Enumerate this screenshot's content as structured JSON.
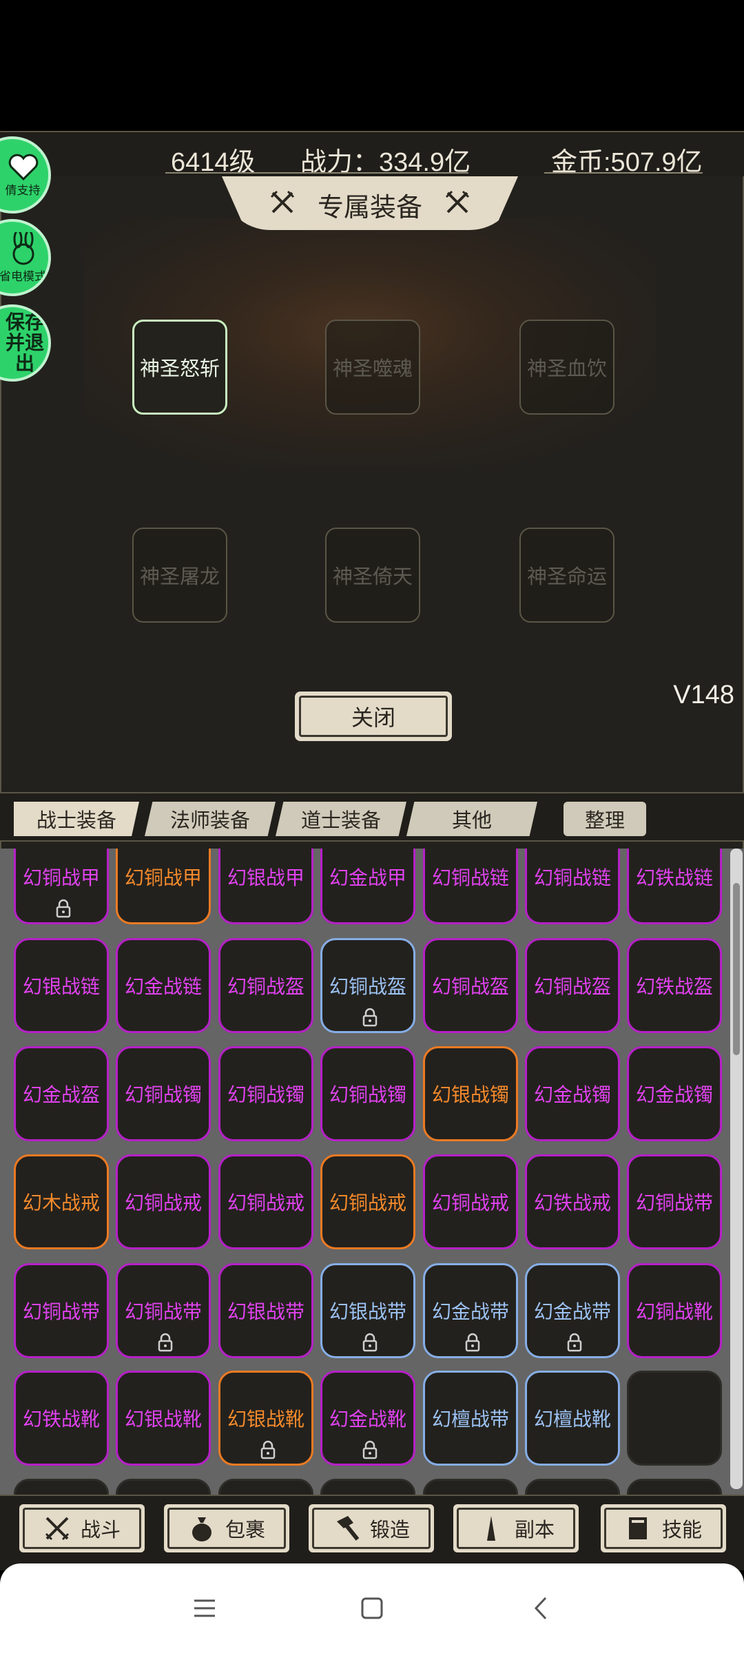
{
  "header": {
    "level": "6414级",
    "power": "战力：334.9亿",
    "gold": "金币:507.9亿"
  },
  "panel": {
    "title": "专属装备",
    "slots": [
      "神圣怒斩",
      "神圣噬魂",
      "神圣血饮",
      "神圣屠龙",
      "神圣倚天",
      "神圣命运"
    ],
    "version": "V148",
    "close_label": "关闭"
  },
  "side": {
    "support": "倩支持",
    "power_mode": "省电模式",
    "save_exit": "保存并退出"
  },
  "tabs": [
    "战士装备",
    "法师装备",
    "道士装备",
    "其他"
  ],
  "sort_label": "整理",
  "inventory": [
    [
      [
        "幻铜战甲",
        "p",
        true
      ],
      [
        "幻铜战甲",
        "o",
        false
      ],
      [
        "幻银战甲",
        "p",
        false
      ],
      [
        "幻金战甲",
        "p",
        false
      ],
      [
        "幻铜战链",
        "p",
        false
      ],
      [
        "幻铜战链",
        "p",
        false
      ],
      [
        "幻铁战链",
        "p",
        false
      ]
    ],
    [
      [
        "幻银战链",
        "p",
        false
      ],
      [
        "幻金战链",
        "p",
        false
      ],
      [
        "幻铜战盔",
        "p",
        false
      ],
      [
        "幻铜战盔",
        "b",
        true
      ],
      [
        "幻铜战盔",
        "p",
        false
      ],
      [
        "幻铜战盔",
        "p",
        false
      ],
      [
        "幻铁战盔",
        "p",
        false
      ]
    ],
    [
      [
        "幻金战盔",
        "p",
        false
      ],
      [
        "幻铜战镯",
        "p",
        false
      ],
      [
        "幻铜战镯",
        "p",
        false
      ],
      [
        "幻铜战镯",
        "p",
        false
      ],
      [
        "幻银战镯",
        "o",
        false
      ],
      [
        "幻金战镯",
        "p",
        false
      ],
      [
        "幻金战镯",
        "p",
        false
      ]
    ],
    [
      [
        "幻木战戒",
        "o",
        false
      ],
      [
        "幻铜战戒",
        "p",
        false
      ],
      [
        "幻铜战戒",
        "p",
        false
      ],
      [
        "幻铜战戒",
        "o",
        false
      ],
      [
        "幻铜战戒",
        "p",
        false
      ],
      [
        "幻铁战戒",
        "p",
        false
      ],
      [
        "幻铜战带",
        "p",
        false
      ]
    ],
    [
      [
        "幻铜战带",
        "p",
        false
      ],
      [
        "幻铜战带",
        "p",
        true
      ],
      [
        "幻银战带",
        "p",
        false
      ],
      [
        "幻银战带",
        "b",
        true
      ],
      [
        "幻金战带",
        "b",
        true
      ],
      [
        "幻金战带",
        "b",
        true
      ],
      [
        "幻铜战靴",
        "p",
        false
      ]
    ],
    [
      [
        "幻铁战靴",
        "p",
        false
      ],
      [
        "幻银战靴",
        "p",
        false
      ],
      [
        "幻银战靴",
        "o",
        true
      ],
      [
        "幻金战靴",
        "p",
        true
      ],
      [
        "幻檀战带",
        "b",
        false
      ],
      [
        "幻檀战靴",
        "b",
        false
      ],
      [
        "",
        "e",
        false
      ]
    ]
  ],
  "bottom_nav": [
    {
      "label": "战斗",
      "icon": "crossed-swords-icon"
    },
    {
      "label": "包裹",
      "icon": "bag-icon"
    },
    {
      "label": "锻造",
      "icon": "hammer-icon"
    },
    {
      "label": "副本",
      "icon": "tower-icon"
    },
    {
      "label": "技能",
      "icon": "book-icon"
    }
  ],
  "colors": {
    "purple": "#e042ef",
    "orange": "#f48a2c",
    "blue": "#9cc2f3",
    "accent_green": "#2ed26a"
  }
}
